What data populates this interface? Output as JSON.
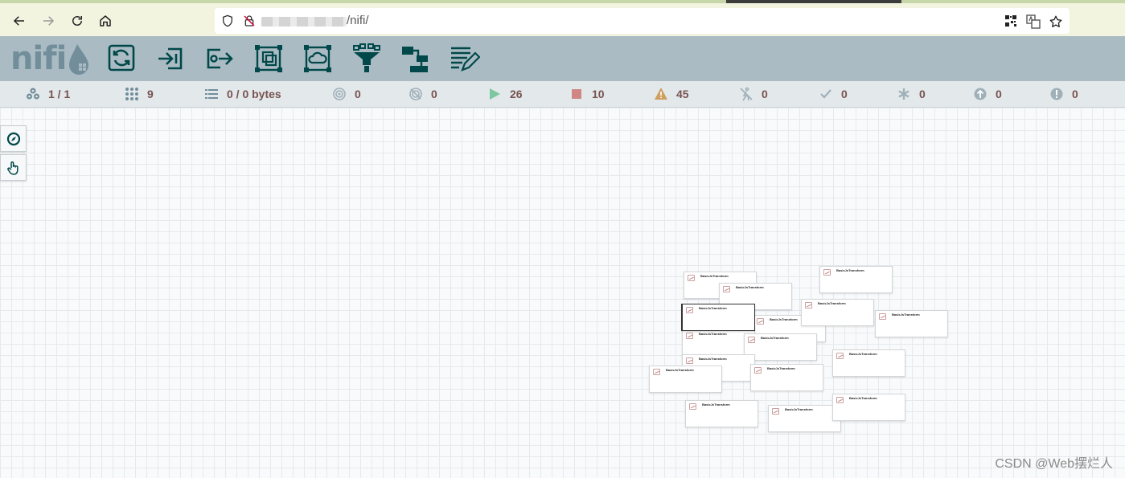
{
  "browser": {
    "url_path": "/nifi/"
  },
  "logo": {
    "text": "nifi"
  },
  "toolbar": [
    {
      "name": "processor-tool-icon"
    },
    {
      "name": "input-port-tool-icon"
    },
    {
      "name": "output-port-tool-icon"
    },
    {
      "name": "process-group-tool-icon"
    },
    {
      "name": "remote-process-group-tool-icon"
    },
    {
      "name": "funnel-tool-icon"
    },
    {
      "name": "template-tool-icon"
    },
    {
      "name": "label-tool-icon"
    }
  ],
  "status": {
    "active_threads": "1 / 1",
    "total_queued_objects": "9",
    "queued": "0 / 0 bytes",
    "transmitting": "0",
    "not_transmitting": "0",
    "running": "26",
    "stopped": "10",
    "invalid": "45",
    "disabled": "0",
    "up_to_date": "0",
    "locally_modified": "0",
    "stale": "0",
    "sync_failure": "0"
  },
  "colors": {
    "running": "#7dc7a0",
    "stopped": "#d18686",
    "invalid": "#cf9f5d",
    "header_bg": "#aabbc3",
    "icon_dark": "#004849"
  },
  "processors": [
    {
      "label": "BasicJsTransform"
    },
    {
      "label": "BasicJsTransform"
    },
    {
      "label": "BasicJsTransform"
    },
    {
      "label": "BasicJsTransform"
    },
    {
      "label": "BasicJsTransform"
    },
    {
      "label": "BasicJsTransform"
    },
    {
      "label": "BasicJsTransform"
    },
    {
      "label": "BasicJsTransform"
    },
    {
      "label": "BasicJsTransform"
    },
    {
      "label": "BasicJsTransform"
    },
    {
      "label": "BasicJsTransform"
    },
    {
      "label": "BasicJsTransform"
    },
    {
      "label": "BasicJsTransform"
    },
    {
      "label": "BasicJsTransform"
    },
    {
      "label": "BasicJsTransform"
    },
    {
      "label": "BasicJsTransform"
    },
    {
      "label": "BasicJsTransform"
    }
  ],
  "watermark": "CSDN @Web摆烂人"
}
